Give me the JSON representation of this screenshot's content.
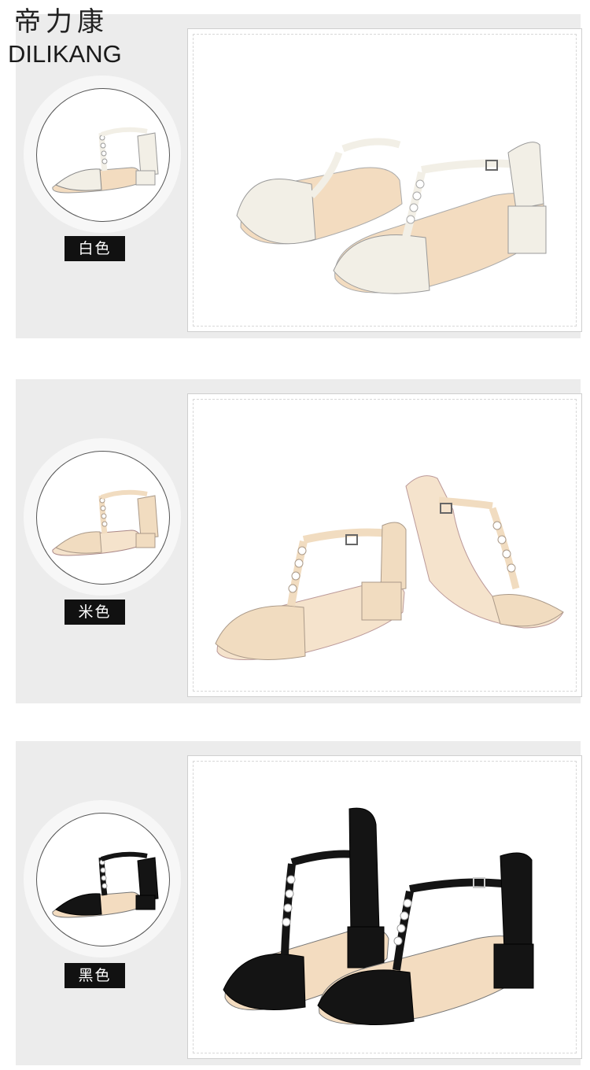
{
  "brand": {
    "cn": "帝力康",
    "en": "DILIKANG"
  },
  "colors": {
    "panel": "#ececec",
    "white_shoe": "#f2efe6",
    "beige_shoe": "#f1dcc0",
    "black_shoe": "#141414",
    "insole": "#f3dcc0",
    "label_bg": "#111111"
  },
  "variants": [
    {
      "color_label": "白色",
      "shoe": "white-sandal"
    },
    {
      "color_label": "米色",
      "shoe": "beige-sandal"
    },
    {
      "color_label": "黑色",
      "shoe": "black-sandal"
    }
  ]
}
